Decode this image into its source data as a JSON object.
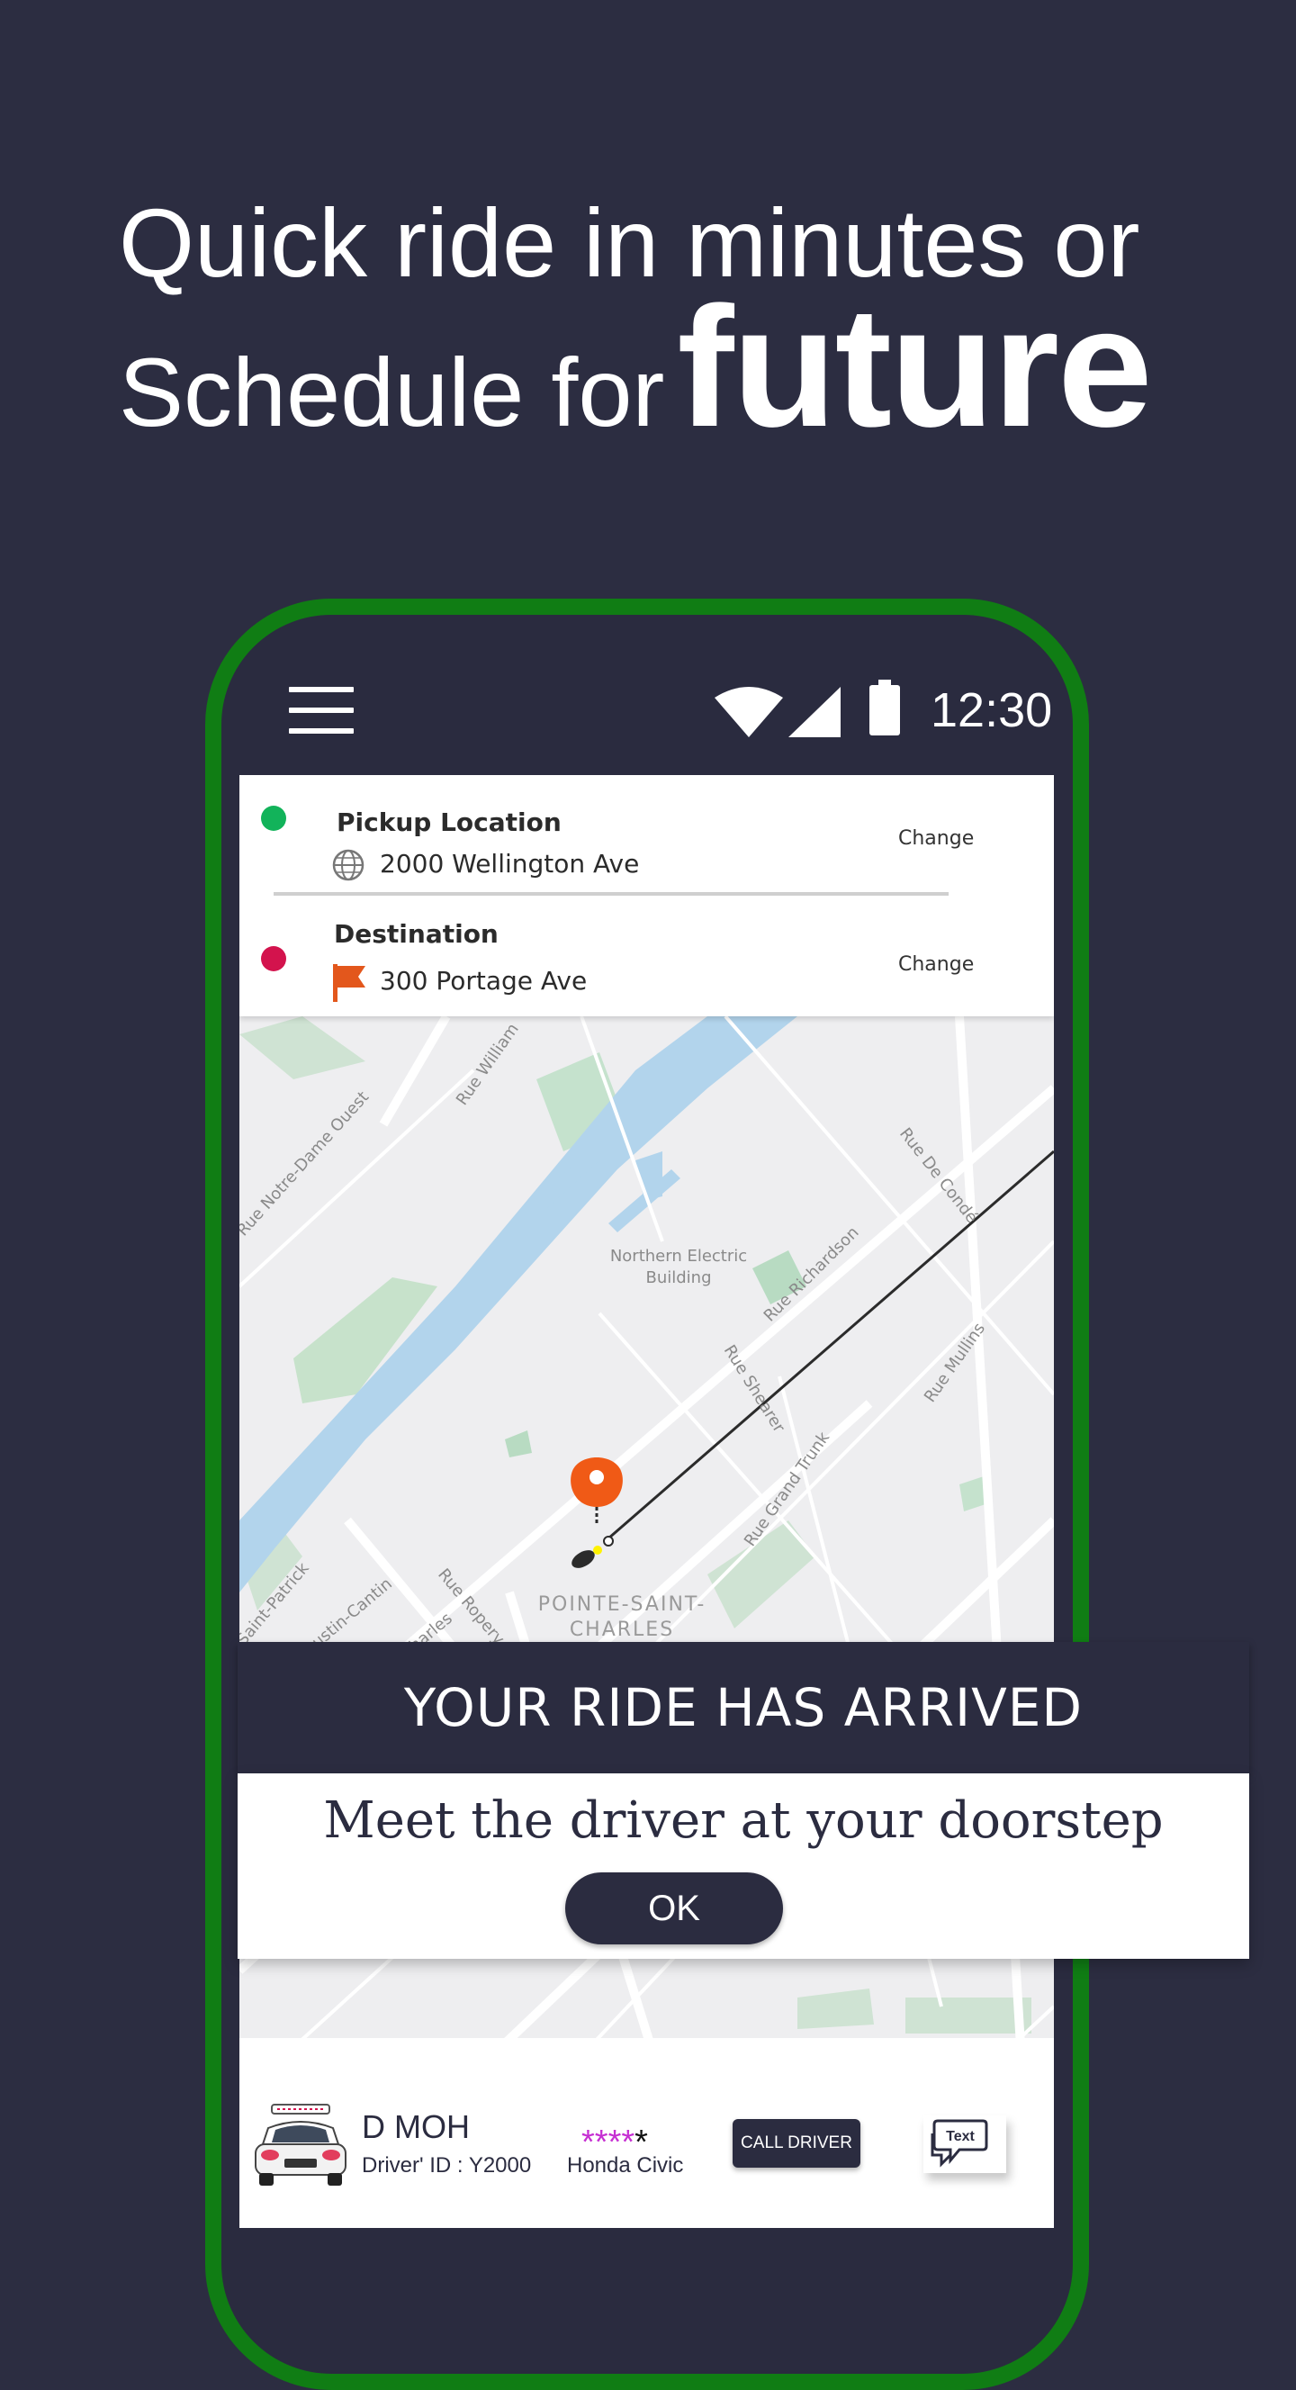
{
  "headline": {
    "line1": "Quick ride in minutes or",
    "line2_prefix": "Schedule for",
    "line2_emphasis": "future"
  },
  "status_bar": {
    "time": "12:30",
    "icons": [
      "menu-icon",
      "wifi-icon",
      "signal-icon",
      "battery-icon"
    ]
  },
  "pickup": {
    "title": "Pickup Location",
    "address": "2000 Wellington Ave",
    "change_label": "Change",
    "dot_color": "#12b35a"
  },
  "destination": {
    "title": "Destination",
    "address": "300 Portage Ave",
    "change_label": "Change",
    "dot_color": "#d3134d"
  },
  "map": {
    "labels": {
      "rue_william": "Rue William",
      "notre_dame": "Rue Notre-Dame Ouest",
      "de_conde": "Rue De Condé",
      "northern_electric": "Northern Electric",
      "building": "Building",
      "richardson": "Rue Richardson",
      "shearer": "Rue Shearer",
      "mullins": "Rue Mullins",
      "grand_trunk": "Rue Grand Trunk",
      "saint_patrick": "Saint-Patrick",
      "augustin_cantin": "Augustin-Cantin",
      "rue_charles": "Rue Charles",
      "rue_ropery": "Rue Ropery",
      "pointe": "POINTE-SAINT-",
      "charles": "CHARLES"
    },
    "accent_pin": "#f05a16"
  },
  "ride_arrived": {
    "banner": "YOUR RIDE HAS ARRIVED",
    "message": "Meet the driver at your doorstep",
    "ok_label": "OK"
  },
  "driver": {
    "name": "D MOH",
    "driver_id": "Driver' ID : Y2000",
    "rating_stars": "****",
    "rating_empty": "*",
    "car_model": "Honda Civic",
    "call_label": "CALL DRIVER",
    "text_label": "Text"
  },
  "colors": {
    "background": "#2c2d41",
    "phone_frame": "#107d14",
    "star": "#c62fd2"
  }
}
